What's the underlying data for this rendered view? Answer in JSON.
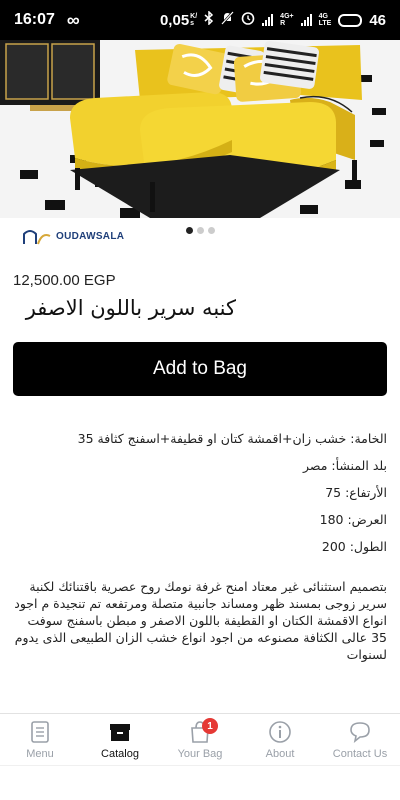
{
  "status_bar": {
    "time": "16:07",
    "speed_value": "0,05",
    "speed_unit_top": "K/",
    "speed_unit_bottom": "s",
    "net_top": "4G+",
    "net_bottom": "R",
    "net2_top": "4G",
    "net2_bottom": "LTE",
    "battery": "46"
  },
  "product": {
    "price": "12,500.00 EGP",
    "title": "كنبه سرير باللون الاصفر",
    "add_to_bag_label": "Add to Bag",
    "brand_logo_text": "OUDAWSALA",
    "image_pages": 3,
    "image_active_index": 0
  },
  "specs": [
    "الخامة: خشب زان+اقمشة كتان او قطيفة+اسفنج كثافة 35",
    "بلد المنشأ: مصر",
    "الأرتفاع: 75",
    "العرض: 180",
    "الطول: 200"
  ],
  "description": "بتصميم استثنائى غير معتاد امنح غرفة نومك روح عصرية باقتنائك لكنبة سرير زوجى بمسند ظهر ومساند جانبية متصلة ومرتفعه تم تنجيدة م اجود انواع الاقمشة الكتان او القطيفة باللون الاصفر و مبطن باسفنج سوفت 35 عالى الكثافة مصنوعه من اجود انواع خشب الزان الطبيعى الذى يدوم لسنوات",
  "tabs": [
    {
      "label": "Menu",
      "icon": "menu-document-icon",
      "active": false
    },
    {
      "label": "Catalog",
      "icon": "catalog-box-icon",
      "active": true
    },
    {
      "label": "Your Bag",
      "icon": "bag-icon",
      "active": false,
      "badge": "1"
    },
    {
      "label": "About",
      "icon": "info-icon",
      "active": false
    },
    {
      "label": "Contact Us",
      "icon": "chat-bubble-icon",
      "active": false
    }
  ],
  "colors": {
    "sofa": "#f2d12e",
    "button_bg": "#000000",
    "badge": "#e53935",
    "inactive_tab": "#9aa0a8"
  }
}
